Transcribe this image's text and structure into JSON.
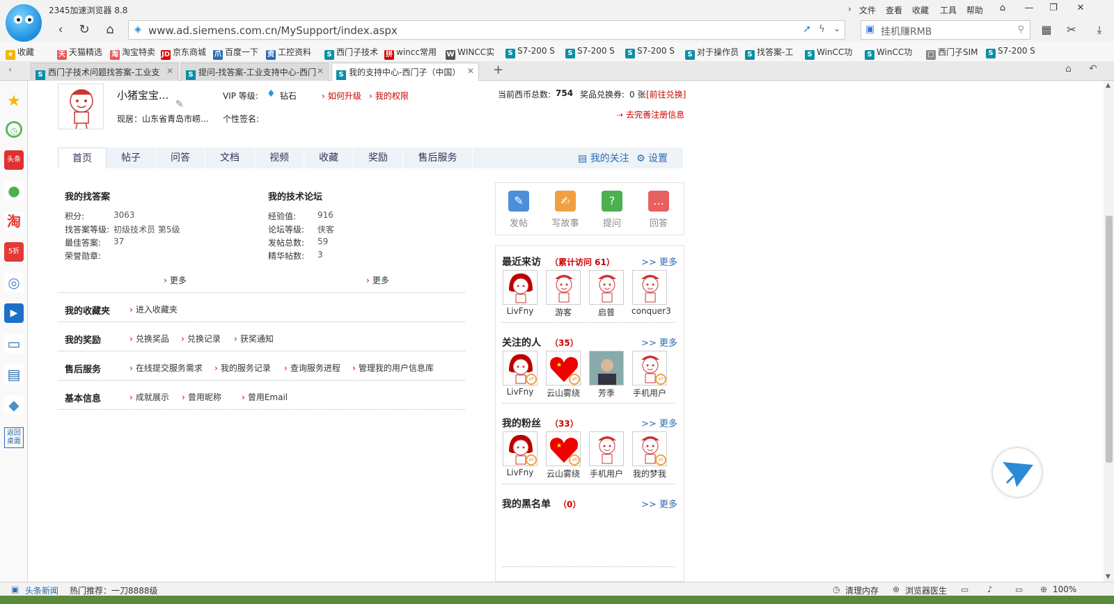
{
  "browser": {
    "app_title": "2345加速浏览器 8.8",
    "menu": [
      "文件",
      "查看",
      "收藏",
      "工具",
      "帮助"
    ],
    "url": "www.ad.siemens.com.cn/MySupport/index.aspx",
    "search_placeholder": "挂机赚RMB",
    "bookmarks": [
      "收藏",
      "天猫精选",
      "淘宝特卖",
      "京东商城",
      "百度一下",
      "工控资料",
      "西门子技术",
      "wincc常用",
      "WINCC实",
      "S7-200 S",
      "S7-200 S",
      "S7-200 S",
      "对于操作员",
      "找答案-工",
      "WinCC功",
      "WinCC功",
      "西门子SIM",
      "S7-200 S"
    ],
    "tabs": [
      "西门子技术问题找答案-工业支",
      "提问-找答案-工业支持中心-西门",
      "我的支持中心-西门子（中国）"
    ],
    "status": {
      "news": "头条新闻",
      "hot": "热门推荐：一刀8888级",
      "clean": "清理内存",
      "doctor": "浏览器医生",
      "zoom": "100%"
    }
  },
  "profile": {
    "name": "小猪宝宝...",
    "vip_label": "VIP 等级:",
    "vip_value": "钻石",
    "upgrade": "如何升级",
    "perm": "我的权限",
    "location": "现居：山东省青岛市崂...",
    "sign_label": "个性签名:",
    "coins_label": "当前西币总数:",
    "coins_value": "754",
    "voucher_label": "奖品兑换券:",
    "voucher_value": "0 张",
    "exchange": "[前往兑换]",
    "complete": "去完善注册信息"
  },
  "page_tabs": [
    "首页",
    "帖子",
    "问答",
    "文档",
    "视频",
    "收藏",
    "奖励",
    "售后服务"
  ],
  "page_tabs_right": {
    "follow": "我的关注",
    "settings": "设置"
  },
  "answers": {
    "title": "我的找答案",
    "rows": [
      {
        "k": "积分:",
        "v": "3063"
      },
      {
        "k": "找答案等级:",
        "v": "初级技术员 第5级"
      },
      {
        "k": "最佳答案:",
        "v": "37"
      },
      {
        "k": "荣誉勋章:",
        "v": ""
      }
    ],
    "more": "更多"
  },
  "forum": {
    "title": "我的技术论坛",
    "rows": [
      {
        "k": "经验值:",
        "v": "916"
      },
      {
        "k": "论坛等级:",
        "v": "侠客"
      },
      {
        "k": "发帖总数:",
        "v": "59"
      },
      {
        "k": "精华帖数:",
        "v": "3"
      }
    ],
    "more": "更多"
  },
  "sections": [
    {
      "title": "我的收藏夹",
      "links": [
        "进入收藏夹"
      ]
    },
    {
      "title": "我的奖励",
      "links": [
        "兑换奖品",
        "兑换记录",
        "获奖通知"
      ]
    },
    {
      "title": "售后服务",
      "links": [
        "在线提交服务需求",
        "我的服务记录",
        "查询服务进程",
        "管理我的用户信息库"
      ]
    },
    {
      "title": "基本信息",
      "links": [
        "成就展示",
        "曾用昵称",
        "曾用Email"
      ]
    }
  ],
  "actions": [
    "发帖",
    "写故事",
    "提问",
    "回答"
  ],
  "visitors": {
    "title": "最近来访",
    "count": "（累计访问 61）",
    "more": ">> 更多",
    "people": [
      "LivFny",
      "游客",
      "启普",
      "conquer3"
    ]
  },
  "following": {
    "title": "关注的人",
    "count": "（35）",
    "more": ">> 更多",
    "people": [
      "LivFny",
      "云山雾绕",
      "芳季",
      "手机用户"
    ]
  },
  "fans": {
    "title": "我的粉丝",
    "count": "（33）",
    "more": ">> 更多",
    "people": [
      "LivFny",
      "云山雾绕",
      "手机用户",
      "我的梦我"
    ]
  },
  "blacklist": {
    "title": "我的黑名单",
    "count": "（0）",
    "more": ">> 更多"
  },
  "colors": {
    "accent_red": "#c00000",
    "link_blue": "#2a6bb0",
    "tab_bg": "#eef3f8"
  }
}
